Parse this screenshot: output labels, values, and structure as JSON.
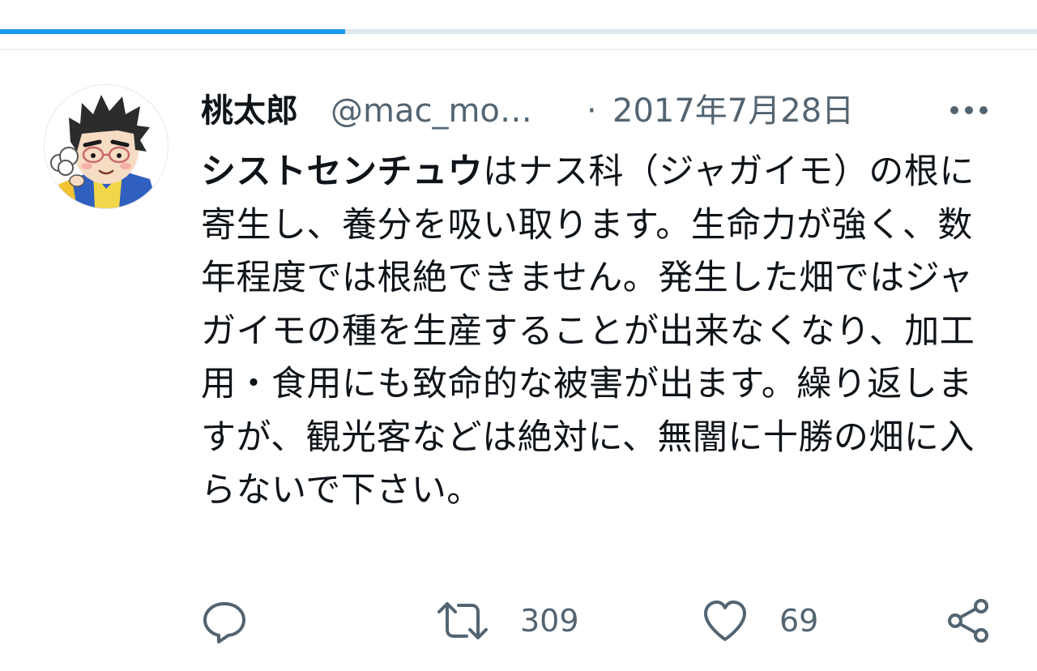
{
  "progress": {
    "fraction": 0.333
  },
  "tweet": {
    "display_name": "桃太郎",
    "handle": "@mac_mo…",
    "separator": "·",
    "date": "2017年7月28日",
    "text_bold": "シストセンチュウ",
    "text_rest": "はナス科（ジャガイモ）の根に寄生し、養分を吸い取ります。生命力が強く、数年程度では根絶できません。発生した畑ではジャガイモの種を生産することが出来なくなり、加工用・食用にも致命的な被害が出ます。繰り返しますが、観光客などは絶対に、無闇に十勝の畑に入らないで下さい。"
  },
  "actions": {
    "reply": {
      "icon": "reply-icon"
    },
    "retweet": {
      "icon": "retweet-icon",
      "count": "309"
    },
    "like": {
      "icon": "heart-icon",
      "count": "69"
    },
    "share": {
      "icon": "share-icon"
    }
  },
  "colors": {
    "accent": "#1d9bf0",
    "secondary_text": "#536471",
    "primary_text": "#0f1419"
  }
}
